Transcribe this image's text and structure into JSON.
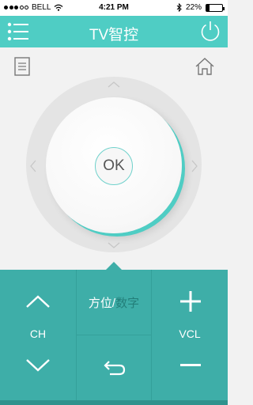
{
  "status_bar": {
    "carrier": "BELL",
    "time": "4:21 PM",
    "battery": "22%",
    "battery_level": 0.22,
    "signal_bars_filled": 3,
    "signal_bars_total": 5
  },
  "nav": {
    "title": "TV智控",
    "menu_icon": "list-menu-icon",
    "power_icon": "power-icon"
  },
  "toolbar": {
    "left_icon": "document-icon",
    "right_icon": "home-icon"
  },
  "dpad": {
    "ok_label": "OK"
  },
  "controls": {
    "channel_label": "CH",
    "volume_label": "VCL",
    "mode_primary": "方位",
    "mode_separator": "/",
    "mode_secondary": "数字",
    "back_icon": "back-arrow-icon"
  },
  "colors": {
    "accent": "#4fcdc4",
    "panel": "#3eaea8",
    "mode_inactive": "#237f7a"
  }
}
